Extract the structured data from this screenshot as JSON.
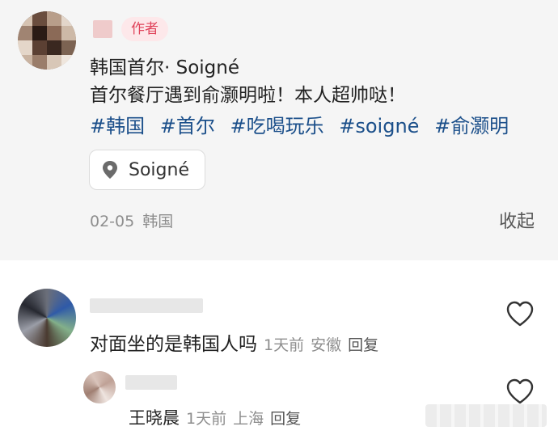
{
  "post": {
    "author_badge": "作者",
    "title": "韩国首尔· Soigné",
    "body": "首尔餐厅遇到俞灏明啦！本人超帅哒！",
    "tags": [
      "#韩国",
      "#首尔",
      "#吃喝玩乐",
      "#soigné",
      "#俞灏明"
    ],
    "location": "Soigné",
    "date": "02-05",
    "region": "韩国",
    "collapse_label": "收起"
  },
  "comments": [
    {
      "text": "对面坐的是韩国人吗",
      "time": "1天前",
      "region": "安徽",
      "reply_label": "回复",
      "replies": [
        {
          "text": "王晓晨",
          "time": "1天前",
          "region": "上海",
          "reply_label": "回复"
        }
      ]
    }
  ],
  "icons": {
    "location": "location-pin-icon",
    "like": "heart-outline-icon"
  },
  "colors": {
    "author_badge_bg": "#fde8ea",
    "author_badge_text": "#e0445b",
    "tag_text": "#1b4f8a",
    "post_bg": "#f5f5f5",
    "muted_text": "#8e8e8e"
  }
}
